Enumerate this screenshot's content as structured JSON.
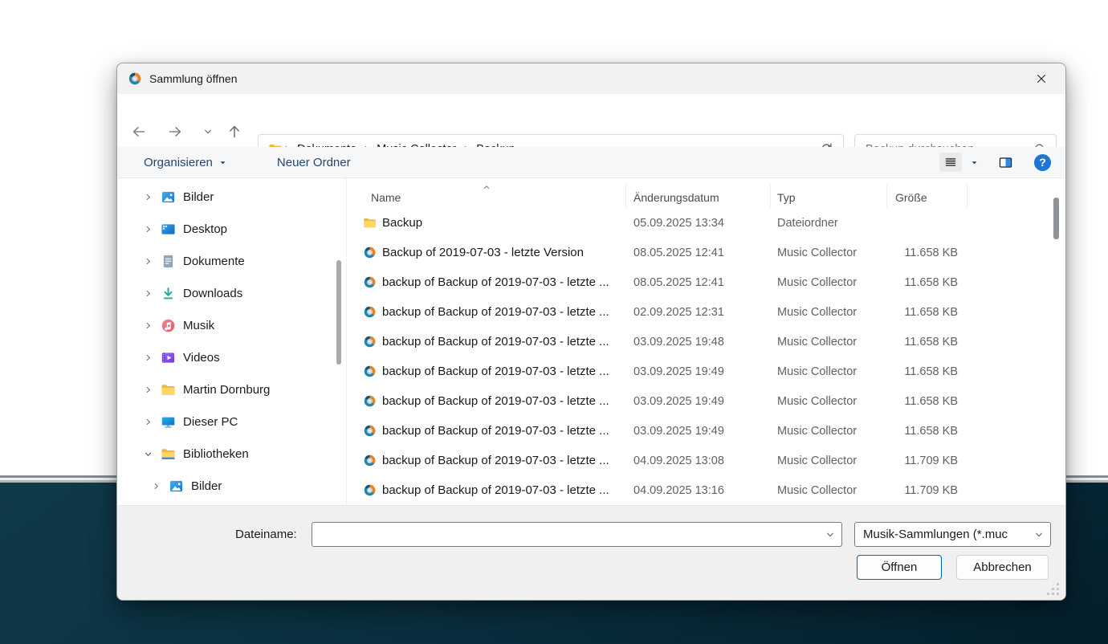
{
  "window": {
    "title": "Sammlung öffnen"
  },
  "nav": {
    "breadcrumb": [
      "Dokumente",
      "Music Collector",
      "Backup"
    ],
    "search_placeholder": "Backup durchsuchen"
  },
  "toolbar": {
    "organize": "Organisieren",
    "new_folder": "Neuer Ordner",
    "help_glyph": "?"
  },
  "sidebar": {
    "items": [
      {
        "label": "Bilder",
        "icon": "pictures",
        "level": 0,
        "expanded": false
      },
      {
        "label": "Desktop",
        "icon": "desktop",
        "level": 0,
        "expanded": false
      },
      {
        "label": "Dokumente",
        "icon": "documents",
        "level": 0,
        "expanded": false
      },
      {
        "label": "Downloads",
        "icon": "downloads",
        "level": 0,
        "expanded": false
      },
      {
        "label": "Musik",
        "icon": "music",
        "level": 0,
        "expanded": false
      },
      {
        "label": "Videos",
        "icon": "videos",
        "level": 0,
        "expanded": false
      },
      {
        "label": "Martin Dornburg",
        "icon": "folder",
        "level": 0,
        "expanded": false
      },
      {
        "label": "Dieser PC",
        "icon": "thispc",
        "level": 0,
        "expanded": false
      },
      {
        "label": "Bibliotheken",
        "icon": "libraries",
        "level": 0,
        "expanded": true
      },
      {
        "label": "Bilder",
        "icon": "pictures",
        "level": 1,
        "expanded": false
      }
    ]
  },
  "file_list": {
    "columns": [
      {
        "label": "Name",
        "sorted": true
      },
      {
        "label": "Änderungsdatum",
        "sorted": false
      },
      {
        "label": "Typ",
        "sorted": false
      },
      {
        "label": "Größe",
        "sorted": false
      }
    ],
    "rows": [
      {
        "icon": "folder",
        "name": "Backup",
        "modified": "05.09.2025 13:34",
        "type": "Dateiordner",
        "size": ""
      },
      {
        "icon": "muc",
        "name": "Backup of 2019-07-03 - letzte Version",
        "modified": "08.05.2025 12:41",
        "type": "Music Collector",
        "size": "11.658 KB"
      },
      {
        "icon": "muc",
        "name": "backup of Backup of 2019-07-03 - letzte ...",
        "modified": "08.05.2025 12:41",
        "type": "Music Collector",
        "size": "11.658 KB"
      },
      {
        "icon": "muc",
        "name": "backup of Backup of 2019-07-03 - letzte ...",
        "modified": "02.09.2025 12:31",
        "type": "Music Collector",
        "size": "11.658 KB"
      },
      {
        "icon": "muc",
        "name": "backup of Backup of 2019-07-03 - letzte ...",
        "modified": "03.09.2025 19:48",
        "type": "Music Collector",
        "size": "11.658 KB"
      },
      {
        "icon": "muc",
        "name": "backup of Backup of 2019-07-03 - letzte ...",
        "modified": "03.09.2025 19:49",
        "type": "Music Collector",
        "size": "11.658 KB"
      },
      {
        "icon": "muc",
        "name": "backup of Backup of 2019-07-03 - letzte ...",
        "modified": "03.09.2025 19:49",
        "type": "Music Collector",
        "size": "11.658 KB"
      },
      {
        "icon": "muc",
        "name": "backup of Backup of 2019-07-03 - letzte ...",
        "modified": "03.09.2025 19:49",
        "type": "Music Collector",
        "size": "11.658 KB"
      },
      {
        "icon": "muc",
        "name": "backup of Backup of 2019-07-03 - letzte ...",
        "modified": "04.09.2025 13:08",
        "type": "Music Collector",
        "size": "11.709 KB"
      },
      {
        "icon": "muc",
        "name": "backup of Backup of 2019-07-03 - letzte ...",
        "modified": "04.09.2025 13:16",
        "type": "Music Collector",
        "size": "11.709 KB"
      }
    ]
  },
  "footer": {
    "filename_label": "Dateiname:",
    "filename_value": "",
    "filetype_value": "Musik-Sammlungen (*.muc",
    "open": "Öffnen",
    "cancel": "Abbrechen"
  },
  "colors": {
    "accent_blue": "#0067c0",
    "help_blue": "#1d76d2",
    "dark_background": "#0a3040",
    "toolbar_text": "#26476b"
  }
}
